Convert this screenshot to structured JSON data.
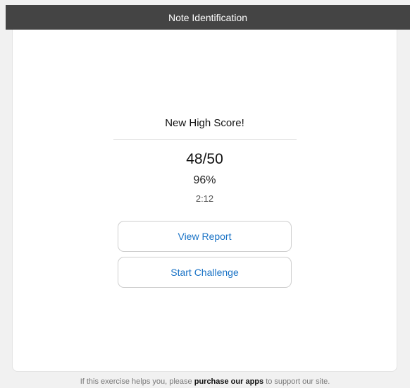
{
  "header": {
    "title": "Note Identification"
  },
  "result": {
    "headline": "New High Score!",
    "score": "48/50",
    "percent": "96%",
    "time": "2:12"
  },
  "actions": {
    "view_report_label": "View Report",
    "start_challenge_label": "Start Challenge"
  },
  "footer": {
    "prefix": "If this exercise helps you, please ",
    "link_text": "purchase our apps",
    "suffix": " to support our site."
  },
  "colors": {
    "titlebar_bg": "#444444",
    "button_text": "#1a73c6",
    "page_bg": "#f1f1f1"
  }
}
